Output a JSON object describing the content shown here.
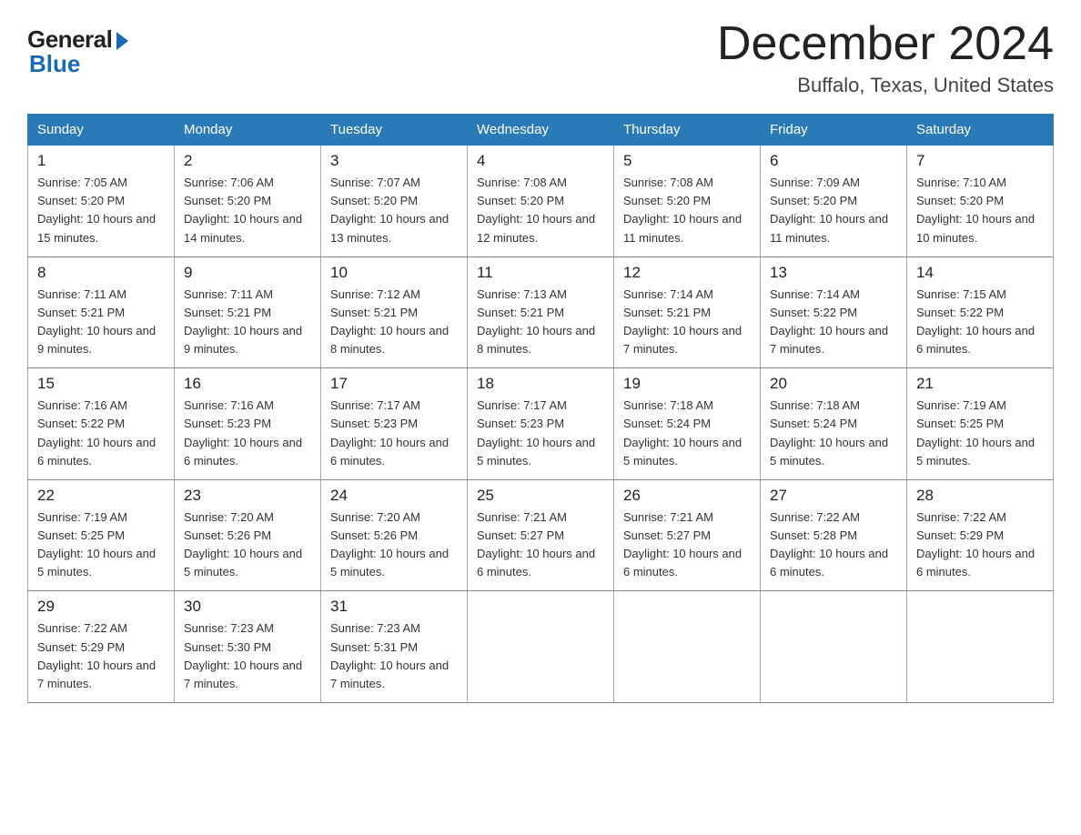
{
  "logo": {
    "general_text": "General",
    "blue_text": "Blue"
  },
  "header": {
    "month_title": "December 2024",
    "location": "Buffalo, Texas, United States"
  },
  "weekdays": [
    "Sunday",
    "Monday",
    "Tuesday",
    "Wednesday",
    "Thursday",
    "Friday",
    "Saturday"
  ],
  "weeks": [
    [
      {
        "day": "1",
        "sunrise": "7:05 AM",
        "sunset": "5:20 PM",
        "daylight": "10 hours and 15 minutes."
      },
      {
        "day": "2",
        "sunrise": "7:06 AM",
        "sunset": "5:20 PM",
        "daylight": "10 hours and 14 minutes."
      },
      {
        "day": "3",
        "sunrise": "7:07 AM",
        "sunset": "5:20 PM",
        "daylight": "10 hours and 13 minutes."
      },
      {
        "day": "4",
        "sunrise": "7:08 AM",
        "sunset": "5:20 PM",
        "daylight": "10 hours and 12 minutes."
      },
      {
        "day": "5",
        "sunrise": "7:08 AM",
        "sunset": "5:20 PM",
        "daylight": "10 hours and 11 minutes."
      },
      {
        "day": "6",
        "sunrise": "7:09 AM",
        "sunset": "5:20 PM",
        "daylight": "10 hours and 11 minutes."
      },
      {
        "day": "7",
        "sunrise": "7:10 AM",
        "sunset": "5:20 PM",
        "daylight": "10 hours and 10 minutes."
      }
    ],
    [
      {
        "day": "8",
        "sunrise": "7:11 AM",
        "sunset": "5:21 PM",
        "daylight": "10 hours and 9 minutes."
      },
      {
        "day": "9",
        "sunrise": "7:11 AM",
        "sunset": "5:21 PM",
        "daylight": "10 hours and 9 minutes."
      },
      {
        "day": "10",
        "sunrise": "7:12 AM",
        "sunset": "5:21 PM",
        "daylight": "10 hours and 8 minutes."
      },
      {
        "day": "11",
        "sunrise": "7:13 AM",
        "sunset": "5:21 PM",
        "daylight": "10 hours and 8 minutes."
      },
      {
        "day": "12",
        "sunrise": "7:14 AM",
        "sunset": "5:21 PM",
        "daylight": "10 hours and 7 minutes."
      },
      {
        "day": "13",
        "sunrise": "7:14 AM",
        "sunset": "5:22 PM",
        "daylight": "10 hours and 7 minutes."
      },
      {
        "day": "14",
        "sunrise": "7:15 AM",
        "sunset": "5:22 PM",
        "daylight": "10 hours and 6 minutes."
      }
    ],
    [
      {
        "day": "15",
        "sunrise": "7:16 AM",
        "sunset": "5:22 PM",
        "daylight": "10 hours and 6 minutes."
      },
      {
        "day": "16",
        "sunrise": "7:16 AM",
        "sunset": "5:23 PM",
        "daylight": "10 hours and 6 minutes."
      },
      {
        "day": "17",
        "sunrise": "7:17 AM",
        "sunset": "5:23 PM",
        "daylight": "10 hours and 6 minutes."
      },
      {
        "day": "18",
        "sunrise": "7:17 AM",
        "sunset": "5:23 PM",
        "daylight": "10 hours and 5 minutes."
      },
      {
        "day": "19",
        "sunrise": "7:18 AM",
        "sunset": "5:24 PM",
        "daylight": "10 hours and 5 minutes."
      },
      {
        "day": "20",
        "sunrise": "7:18 AM",
        "sunset": "5:24 PM",
        "daylight": "10 hours and 5 minutes."
      },
      {
        "day": "21",
        "sunrise": "7:19 AM",
        "sunset": "5:25 PM",
        "daylight": "10 hours and 5 minutes."
      }
    ],
    [
      {
        "day": "22",
        "sunrise": "7:19 AM",
        "sunset": "5:25 PM",
        "daylight": "10 hours and 5 minutes."
      },
      {
        "day": "23",
        "sunrise": "7:20 AM",
        "sunset": "5:26 PM",
        "daylight": "10 hours and 5 minutes."
      },
      {
        "day": "24",
        "sunrise": "7:20 AM",
        "sunset": "5:26 PM",
        "daylight": "10 hours and 5 minutes."
      },
      {
        "day": "25",
        "sunrise": "7:21 AM",
        "sunset": "5:27 PM",
        "daylight": "10 hours and 6 minutes."
      },
      {
        "day": "26",
        "sunrise": "7:21 AM",
        "sunset": "5:27 PM",
        "daylight": "10 hours and 6 minutes."
      },
      {
        "day": "27",
        "sunrise": "7:22 AM",
        "sunset": "5:28 PM",
        "daylight": "10 hours and 6 minutes."
      },
      {
        "day": "28",
        "sunrise": "7:22 AM",
        "sunset": "5:29 PM",
        "daylight": "10 hours and 6 minutes."
      }
    ],
    [
      {
        "day": "29",
        "sunrise": "7:22 AM",
        "sunset": "5:29 PM",
        "daylight": "10 hours and 7 minutes."
      },
      {
        "day": "30",
        "sunrise": "7:23 AM",
        "sunset": "5:30 PM",
        "daylight": "10 hours and 7 minutes."
      },
      {
        "day": "31",
        "sunrise": "7:23 AM",
        "sunset": "5:31 PM",
        "daylight": "10 hours and 7 minutes."
      },
      null,
      null,
      null,
      null
    ]
  ],
  "labels": {
    "sunrise": "Sunrise: ",
    "sunset": "Sunset: ",
    "daylight": "Daylight: "
  }
}
